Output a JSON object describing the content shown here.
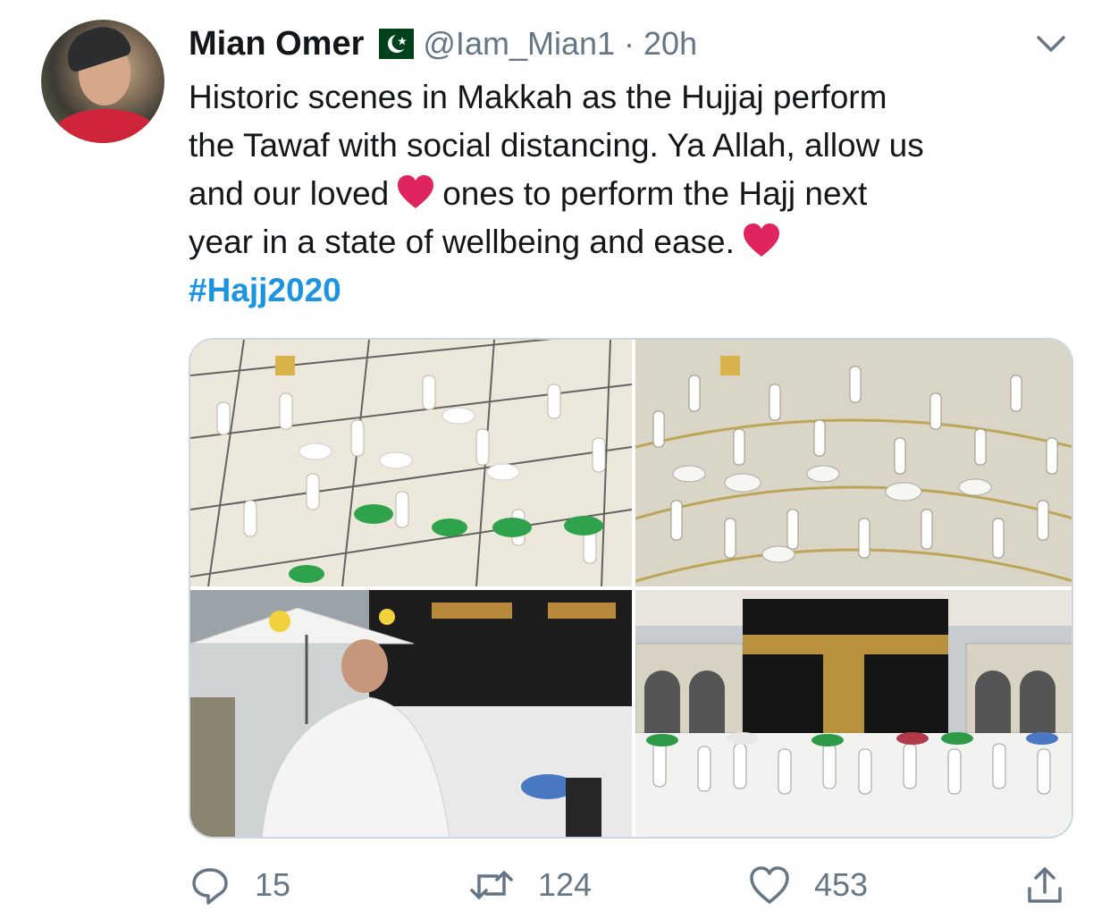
{
  "tweet": {
    "author_name": "Mian Omer",
    "flag_icon": "pakistan-flag-icon",
    "handle": "@Iam_Mian1",
    "separator": "·",
    "time": "20h",
    "text_part1": "Historic scenes in Makkah as the Hujjaj perform\nthe Tawaf with social distancing. Ya Allah, allow us\nand our loved",
    "text_part2": "ones to perform the Hajj next\nyear in a state of wellbeing and ease.",
    "hashtag": "#Hajj2020",
    "heart_color": "#e0245e",
    "link_color": "#1b95e0"
  },
  "media": {
    "photos": [
      {
        "icon": "photo-pilgrims-green-umbrellas"
      },
      {
        "icon": "photo-pilgrims-white-umbrellas"
      },
      {
        "icon": "photo-pilgrim-kaaba-closeup"
      },
      {
        "icon": "photo-kaaba-tawaf"
      }
    ]
  },
  "actions": {
    "reply_count": "15",
    "retweet_count": "124",
    "like_count": "453"
  }
}
